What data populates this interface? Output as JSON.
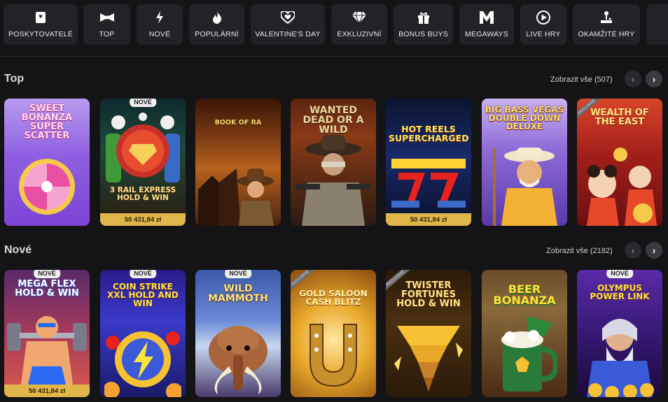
{
  "categories": [
    {
      "label": "POSKYTOVATELÉ",
      "icon": "providers-icon"
    },
    {
      "label": "TOP",
      "icon": "bowtie-icon"
    },
    {
      "label": "NOVÉ",
      "icon": "lightning-icon"
    },
    {
      "label": "POPULÁRNÍ",
      "icon": "flame-icon"
    },
    {
      "label": "VALENTINE'S DAY",
      "icon": "heart-icon"
    },
    {
      "label": "EXKLUZIVNÍ",
      "icon": "diamond-icon"
    },
    {
      "label": "BONUS BUYS",
      "icon": "gift-icon"
    },
    {
      "label": "MEGAWAYS",
      "icon": "megaways-icon"
    },
    {
      "label": "LIVE HRY",
      "icon": "play-icon"
    },
    {
      "label": "OKAMŽITÉ HRY",
      "icon": "joystick-icon"
    }
  ],
  "sections": {
    "top": {
      "title": "Top",
      "view_all": "Zobrazit vše (507)",
      "games": [
        {
          "title": "SWEET BONANZA SUPER SCATTER",
          "badge": "",
          "jackpot": "",
          "exclusive": ""
        },
        {
          "title": "3 RAIL EXPRESS HOLD & WIN",
          "badge": "NOVÉ",
          "jackpot": "50 431,84 zł",
          "exclusive": ""
        },
        {
          "title": "BOOK OF RA",
          "badge": "",
          "jackpot": "",
          "exclusive": ""
        },
        {
          "title": "WANTED DEAD OR A WILD",
          "badge": "",
          "jackpot": "",
          "exclusive": ""
        },
        {
          "title": "HOT REELS SUPERCHARGED",
          "badge": "",
          "jackpot": "50 431,84 zł",
          "exclusive": ""
        },
        {
          "title": "BIG BASS VEGAS DOUBLE DOWN DELUXE",
          "badge": "",
          "jackpot": "",
          "exclusive": ""
        },
        {
          "title": "WEALTH OF THE EAST",
          "badge": "",
          "jackpot": "",
          "exclusive": "EXCLUSIVE"
        }
      ]
    },
    "nove": {
      "title": "Nové",
      "view_all": "Zobrazit vše (2182)",
      "games": [
        {
          "title": "MEGA FLEX HOLD & WIN",
          "badge": "NOVÉ",
          "jackpot": "50 431,84 zł",
          "exclusive": ""
        },
        {
          "title": "COIN STRIKE XXL HOLD AND WIN",
          "badge": "NOVÉ",
          "jackpot": "",
          "exclusive": ""
        },
        {
          "title": "WILD MAMMOTH",
          "badge": "NOVÉ",
          "jackpot": "",
          "exclusive": ""
        },
        {
          "title": "GOLD SALOON CASH BLITZ",
          "badge": "",
          "jackpot": "",
          "exclusive": "EXCLUSIVE"
        },
        {
          "title": "TWISTER FORTUNES HOLD & WIN",
          "badge": "",
          "jackpot": "",
          "exclusive": "EXCLUSIVE"
        },
        {
          "title": "BEER BONANZA",
          "badge": "",
          "jackpot": "",
          "exclusive": ""
        },
        {
          "title": "OLYMPUS POWER LINK",
          "badge": "NOVÉ",
          "jackpot": "",
          "exclusive": ""
        }
      ]
    }
  },
  "nav": {
    "prev": "‹",
    "next": "›"
  },
  "colors": {
    "background": "#141416",
    "tile": "#232327",
    "jackpot": "#e0b64a",
    "badge": "#efefef"
  }
}
